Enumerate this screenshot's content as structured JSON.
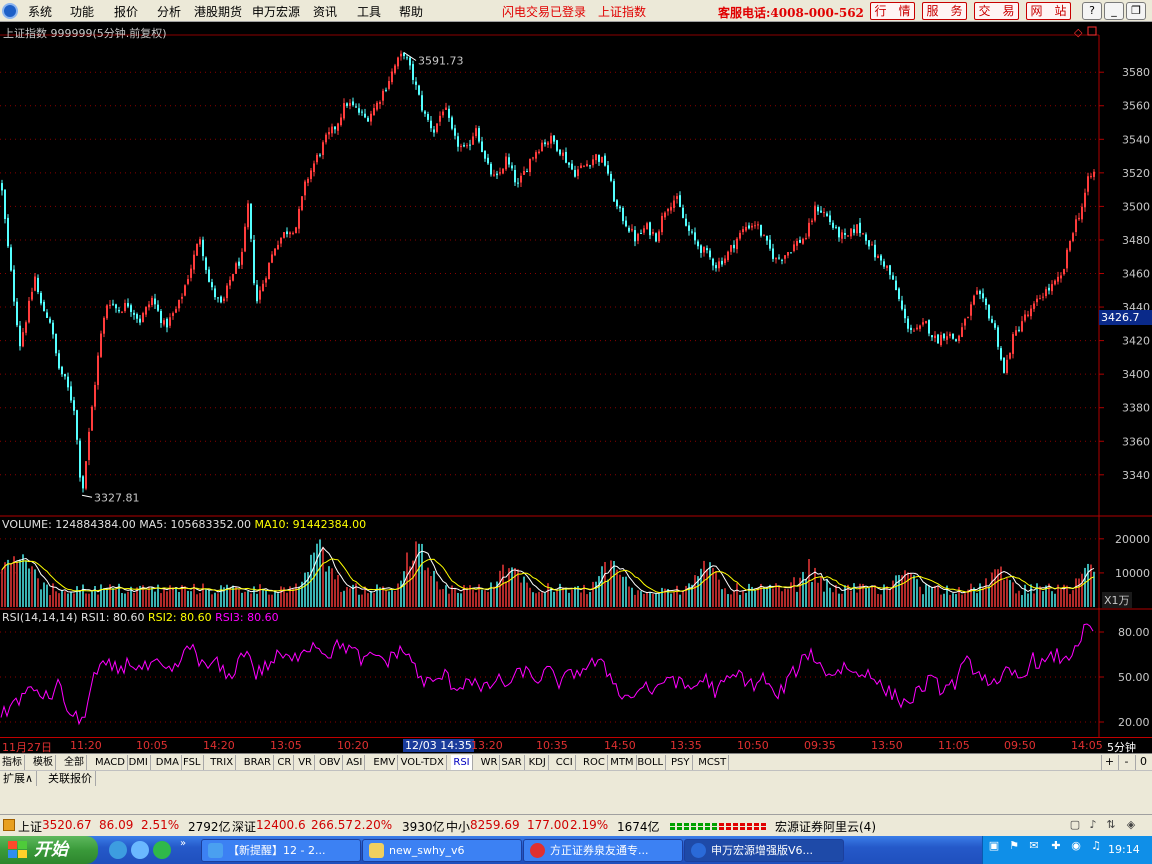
{
  "menu": {
    "items": [
      "系统",
      "功能",
      "报价",
      "分析",
      "港股期货",
      "申万宏源",
      "资讯",
      "工具",
      "帮助"
    ],
    "status": "闪电交易已登录",
    "index_name": "上证指数",
    "hotline": "客服电话:4008-000-562",
    "buttons": [
      "行　情",
      "服　务",
      "交　易",
      "网　站"
    ],
    "window_controls": [
      "help-icon",
      "minimize-icon",
      "restore-icon",
      "close-icon"
    ]
  },
  "chart_header": {
    "title": "上证指数 999999(5分钟.前复权)",
    "high_label": "3591.73",
    "low_label": "3327.81",
    "current_price_tag": "3426.7"
  },
  "volume_header": {
    "volume": "VOLUME: 124884384.00",
    "ma5": "MA5: 105683352.00",
    "ma10": "MA10: 91442384.00",
    "unit": "X1万"
  },
  "rsi_header": {
    "name": "RSI(14,14,14)",
    "rsi1": "RSI1: 80.60",
    "rsi2": "RSI2: 80.60",
    "rsi3": "RSI3: 80.60"
  },
  "time_axis": {
    "labels": [
      "11月27日",
      "11:20",
      "10:05",
      "14:20",
      "13:05",
      "10:20",
      "13:20",
      "10:35",
      "14:50",
      "13:35",
      "10:50",
      "09:35",
      "13:50",
      "11:05",
      "09:50",
      "14:05"
    ],
    "cursor": "12/03 14:35",
    "period": "5分钟"
  },
  "indicator_tabs": [
    "指标",
    "模板",
    "全部",
    "MACD",
    "DMI",
    "DMA",
    "FSL",
    "TRIX",
    "BRAR",
    "CR",
    "VR",
    "OBV",
    "ASI",
    "EMV",
    "VOL-TDX",
    "RSI",
    "WR",
    "SAR",
    "KDJ",
    "CCI",
    "ROC",
    "MTM",
    "BOLL",
    "PSY",
    "MCST"
  ],
  "active_tab": "RSI",
  "tab_controls": [
    "+",
    "-",
    "0"
  ],
  "ext_tabs": [
    "扩展∧",
    "关联报价"
  ],
  "statusbar": {
    "sh_name": "上证",
    "sh_value": "3520.67",
    "sh_change": "86.09",
    "sh_pct": "2.51%",
    "sh_amount": "2792亿",
    "sz_name": "深证",
    "sz_value": "12400.6",
    "sz_change": "266.57",
    "sz_pct": "2.20%",
    "sz_amount": "3930亿",
    "zx_name": "中小",
    "zx_value": "8259.69",
    "zx_change": "177.00",
    "zx_pct": "2.19%",
    "zx_amount": "1674亿",
    "server": "宏源证券阿里云(4)"
  },
  "taskbar": {
    "start": "开始",
    "tasks": [
      "【新提醒】12 - 2...",
      "new_swhy_v6",
      "方正证券泉友通专...",
      "申万宏源增强版V6..."
    ],
    "clock": "19:14"
  },
  "colors": {
    "up": "#ff3c3c",
    "down": "#54ffff",
    "ma5": "#ffffff",
    "ma10": "#ffff00",
    "rsi": "#ff00ff",
    "grid": "#8b0000"
  },
  "chart_data": [
    {
      "type": "candlestick",
      "title": "上证指数 999999(5分钟.前复权)",
      "y_ticks": [
        3340,
        3360,
        3380,
        3400,
        3420,
        3440,
        3460,
        3480,
        3500,
        3520,
        3540,
        3560,
        3580
      ],
      "ylim": [
        3322,
        3598
      ],
      "annotations": [
        {
          "label": "3591.73",
          "value": 3591.73
        },
        {
          "label": "3327.81",
          "value": 3327.81
        }
      ],
      "last": 3520.67,
      "path": [
        [
          0,
          3520
        ],
        [
          7,
          3480
        ],
        [
          14,
          3445
        ],
        [
          20,
          3418
        ],
        [
          28,
          3438
        ],
        [
          35,
          3458
        ],
        [
          40,
          3442
        ],
        [
          50,
          3432
        ],
        [
          58,
          3405
        ],
        [
          66,
          3395
        ],
        [
          74,
          3380
        ],
        [
          82,
          3327.81
        ],
        [
          92,
          3380
        ],
        [
          100,
          3420
        ],
        [
          108,
          3445
        ],
        [
          118,
          3438
        ],
        [
          128,
          3442
        ],
        [
          140,
          3432
        ],
        [
          152,
          3445
        ],
        [
          165,
          3428
        ],
        [
          178,
          3440
        ],
        [
          190,
          3462
        ],
        [
          200,
          3482
        ],
        [
          210,
          3452
        ],
        [
          222,
          3440
        ],
        [
          232,
          3460
        ],
        [
          242,
          3470
        ],
        [
          248,
          3500
        ],
        [
          256,
          3442
        ],
        [
          266,
          3460
        ],
        [
          276,
          3478
        ],
        [
          286,
          3485
        ],
        [
          296,
          3488
        ],
        [
          306,
          3515
        ],
        [
          316,
          3528
        ],
        [
          326,
          3540
        ],
        [
          336,
          3548
        ],
        [
          346,
          3562
        ],
        [
          356,
          3558
        ],
        [
          366,
          3552
        ],
        [
          376,
          3560
        ],
        [
          386,
          3572
        ],
        [
          396,
          3585
        ],
        [
          404,
          3591.73
        ],
        [
          414,
          3575
        ],
        [
          424,
          3555
        ],
        [
          434,
          3545
        ],
        [
          444,
          3560
        ],
        [
          454,
          3540
        ],
        [
          466,
          3532
        ],
        [
          476,
          3548
        ],
        [
          486,
          3525
        ],
        [
          496,
          3515
        ],
        [
          506,
          3528
        ],
        [
          518,
          3512
        ],
        [
          530,
          3528
        ],
        [
          542,
          3538
        ],
        [
          552,
          3540
        ],
        [
          562,
          3532
        ],
        [
          574,
          3520
        ],
        [
          586,
          3525
        ],
        [
          596,
          3530
        ],
        [
          606,
          3525
        ],
        [
          616,
          3500
        ],
        [
          626,
          3490
        ],
        [
          636,
          3480
        ],
        [
          646,
          3488
        ],
        [
          656,
          3482
        ],
        [
          666,
          3500
        ],
        [
          676,
          3505
        ],
        [
          686,
          3488
        ],
        [
          696,
          3478
        ],
        [
          706,
          3472
        ],
        [
          716,
          3465
        ],
        [
          726,
          3470
        ],
        [
          736,
          3480
        ],
        [
          746,
          3488
        ],
        [
          756,
          3490
        ],
        [
          766,
          3478
        ],
        [
          776,
          3468
        ],
        [
          786,
          3472
        ],
        [
          796,
          3478
        ],
        [
          806,
          3482
        ],
        [
          816,
          3500
        ],
        [
          826,
          3495
        ],
        [
          836,
          3485
        ],
        [
          846,
          3480
        ],
        [
          856,
          3488
        ],
        [
          866,
          3482
        ],
        [
          876,
          3470
        ],
        [
          886,
          3465
        ],
        [
          896,
          3450
        ],
        [
          906,
          3430
        ],
        [
          916,
          3425
        ],
        [
          926,
          3430
        ],
        [
          936,
          3420
        ],
        [
          946,
          3425
        ],
        [
          956,
          3420
        ],
        [
          966,
          3432
        ],
        [
          976,
          3448
        ],
        [
          986,
          3440
        ],
        [
          996,
          3425
        ],
        [
          1004,
          3400
        ],
        [
          1012,
          3420
        ],
        [
          1022,
          3432
        ],
        [
          1032,
          3438
        ],
        [
          1042,
          3448
        ],
        [
          1052,
          3452
        ],
        [
          1062,
          3458
        ],
        [
          1072,
          3485
        ],
        [
          1082,
          3500
        ],
        [
          1088,
          3515
        ],
        [
          1094,
          3520.67
        ]
      ]
    },
    {
      "type": "bar",
      "title": "VOLUME",
      "y_ticks": [
        10000,
        20000
      ],
      "ylim": [
        0,
        22000
      ],
      "unit": "X1万",
      "series": [
        {
          "name": "MA5",
          "value": 105683352.0
        },
        {
          "name": "MA10",
          "value": 91442384.0
        }
      ],
      "peaks": [
        [
          12,
          18000
        ],
        [
          24,
          16500
        ],
        [
          320,
          19000
        ],
        [
          416,
          20000
        ],
        [
          512,
          15000
        ],
        [
          610,
          13500
        ],
        [
          706,
          13000
        ],
        [
          810,
          12500
        ],
        [
          906,
          11500
        ],
        [
          1000,
          11000
        ],
        [
          1092,
          14000
        ]
      ]
    },
    {
      "type": "line",
      "title": "RSI(14,14,14)",
      "y_ticks": [
        20.0,
        50.0,
        80.0
      ],
      "ylim": [
        12,
        92
      ],
      "series": [
        {
          "name": "RSI1",
          "last": 80.6
        },
        {
          "name": "RSI2",
          "last": 80.6
        },
        {
          "name": "RSI3",
          "last": 80.6
        }
      ],
      "points": [
        [
          0,
          22
        ],
        [
          12,
          32
        ],
        [
          24,
          38
        ],
        [
          36,
          42
        ],
        [
          48,
          35
        ],
        [
          58,
          45
        ],
        [
          70,
          25
        ],
        [
          82,
          20
        ],
        [
          94,
          50
        ],
        [
          106,
          58
        ],
        [
          118,
          55
        ],
        [
          130,
          60
        ],
        [
          142,
          55
        ],
        [
          156,
          58
        ],
        [
          170,
          52
        ],
        [
          182,
          62
        ],
        [
          192,
          72
        ],
        [
          204,
          55
        ],
        [
          216,
          60
        ],
        [
          228,
          48
        ],
        [
          240,
          62
        ],
        [
          246,
          70
        ],
        [
          256,
          52
        ],
        [
          268,
          58
        ],
        [
          280,
          65
        ],
        [
          292,
          60
        ],
        [
          304,
          70
        ],
        [
          316,
          72
        ],
        [
          328,
          65
        ],
        [
          340,
          72
        ],
        [
          352,
          68
        ],
        [
          364,
          60
        ],
        [
          376,
          65
        ],
        [
          388,
          60
        ],
        [
          398,
          68
        ],
        [
          410,
          65
        ],
        [
          418,
          50
        ],
        [
          432,
          45
        ],
        [
          444,
          52
        ],
        [
          456,
          42
        ],
        [
          470,
          50
        ],
        [
          482,
          40
        ],
        [
          496,
          48
        ],
        [
          510,
          45
        ],
        [
          522,
          55
        ],
        [
          536,
          48
        ],
        [
          548,
          54
        ],
        [
          560,
          46
        ],
        [
          572,
          52
        ],
        [
          584,
          56
        ],
        [
          596,
          60
        ],
        [
          606,
          55
        ],
        [
          616,
          45
        ],
        [
          626,
          35
        ],
        [
          636,
          40
        ],
        [
          646,
          45
        ],
        [
          656,
          38
        ],
        [
          668,
          52
        ],
        [
          680,
          45
        ],
        [
          692,
          42
        ],
        [
          704,
          50
        ],
        [
          716,
          40
        ],
        [
          728,
          48
        ],
        [
          740,
          52
        ],
        [
          752,
          44
        ],
        [
          764,
          50
        ],
        [
          776,
          35
        ],
        [
          788,
          48
        ],
        [
          800,
          58
        ],
        [
          810,
          68
        ],
        [
          822,
          55
        ],
        [
          834,
          52
        ],
        [
          846,
          58
        ],
        [
          858,
          50
        ],
        [
          870,
          55
        ],
        [
          882,
          42
        ],
        [
          894,
          38
        ],
        [
          906,
          32
        ],
        [
          918,
          40
        ],
        [
          930,
          48
        ],
        [
          942,
          42
        ],
        [
          954,
          45
        ],
        [
          966,
          60
        ],
        [
          976,
          55
        ],
        [
          988,
          48
        ],
        [
          998,
          42
        ],
        [
          1008,
          55
        ],
        [
          1020,
          48
        ],
        [
          1032,
          62
        ],
        [
          1044,
          58
        ],
        [
          1056,
          65
        ],
        [
          1066,
          60
        ],
        [
          1076,
          72
        ],
        [
          1086,
          82
        ],
        [
          1094,
          80.6
        ]
      ]
    }
  ]
}
